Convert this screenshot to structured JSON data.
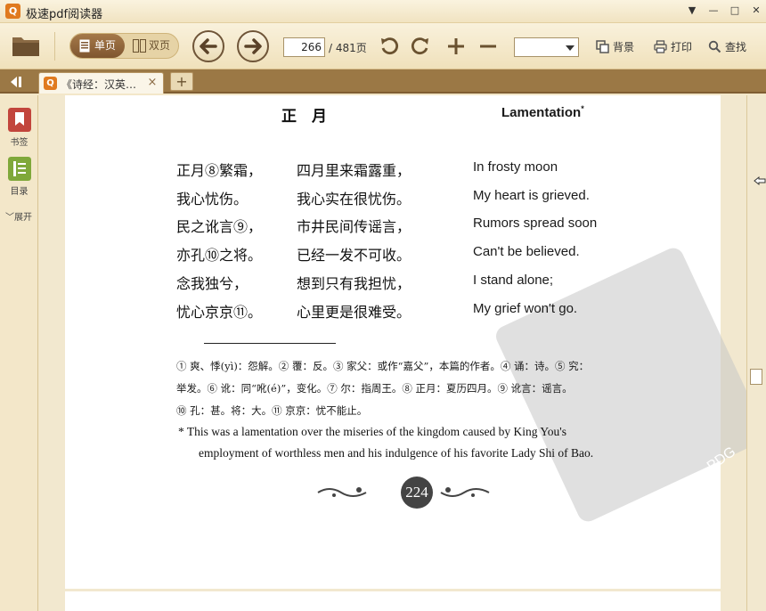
{
  "app": {
    "title": "极速pdf阅读器",
    "logo_text": "Q"
  },
  "window_controls": {
    "menu": "▼",
    "minimize": "—",
    "maximize": "□",
    "close": "✕"
  },
  "toolbar": {
    "single_page_label": "单页",
    "double_page_label": "双页",
    "current_page": "266",
    "total_pages": "/ 481页",
    "zoom_value": "",
    "bookmark_label": "背景",
    "print_label": "打印",
    "find_label": "查找"
  },
  "tabs": [
    {
      "title": "《诗经：汉英…",
      "close": "×"
    }
  ],
  "tab_add": "+",
  "sidebar": {
    "bookmarks_label": "书签",
    "toc_label": "目录",
    "expand_label": "展开"
  },
  "document": {
    "title_cn": "正　月",
    "title_en": "Lamentation",
    "title_en_mark": "*",
    "lines_cn_orig": [
      "正月⑧繁霜，",
      "我心忧伤。",
      "民之讹言⑨，",
      "亦孔⑩之将。",
      "念我独兮，",
      "忧心京京⑪。"
    ],
    "lines_cn_trans": [
      "四月里来霜露重，",
      "我心实在很忧伤。",
      "市井民间传谣言，",
      "已经一发不可收。",
      "想到只有我担忧，",
      "心里更是很难受。"
    ],
    "lines_en": [
      "In frosty moon",
      "My heart is grieved.",
      "Rumors spread soon",
      "Can't be believed.",
      "I stand alone;",
      "My grief won't go."
    ],
    "notes": [
      "① 爽、悸(yì)：怨解。② 覆：反。③ 家父：或作“嘉父”，本篇的作者。④ 诵：诗。⑤ 究：",
      "举发。⑥ 讹：同“吪(é)”，变化。⑦ 尔：指周王。⑧ 正月：夏历四月。⑨ 讹言：谣言。",
      "⑩ 孔：甚。将：大。⑪ 京京：忧不能止。"
    ],
    "footnote_line1": "* This was a lamentation over the miseries of the kingdom caused by King You's",
    "footnote_line2": "employment of worthless men and his indulgence of his favorite Lady Shi of Bao.",
    "page_number": "224",
    "watermark": "PDG"
  }
}
